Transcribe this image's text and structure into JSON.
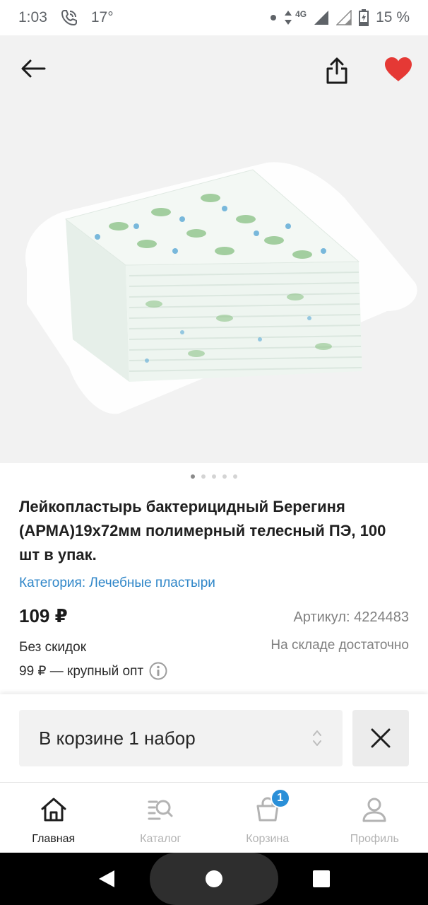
{
  "status_bar": {
    "time": "1:03",
    "temperature": "17°",
    "network": "4G",
    "battery": "15 %"
  },
  "product": {
    "title": "Лейкопластырь бактерицидный Берегиня (АРМА)19х72мм полимерный телесный ПЭ, 100 шт в упак.",
    "category": "Категория: Лечебные пластыри",
    "price": "109 ₽",
    "article": "Артикул: 4224483",
    "discount": "Без скидок",
    "stock": "На складе достаточно",
    "wholesale": "99 ₽ — крупный опт",
    "image_count": 5,
    "active_image": 1
  },
  "cart": {
    "selector_label": "В корзине 1 набор"
  },
  "bottom_nav": {
    "items": [
      {
        "label": "Главная",
        "icon": "home-icon"
      },
      {
        "label": "Каталог",
        "icon": "catalog-search-icon"
      },
      {
        "label": "Корзина",
        "icon": "basket-icon"
      },
      {
        "label": "Профиль",
        "icon": "profile-icon"
      }
    ],
    "cart_badge": "1"
  },
  "colors": {
    "accent_blue": "#2f86c8",
    "favorite_red": "#e53935",
    "image_bg": "#f2f2f2"
  }
}
